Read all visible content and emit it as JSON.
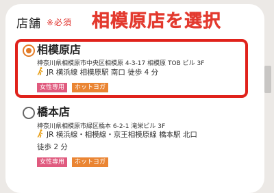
{
  "field": {
    "label": "店舗",
    "required": "※必須"
  },
  "callout": "相模原店を選択",
  "stores": [
    {
      "name": "相模原店",
      "selected": true,
      "address": "神奈川県相模原市中央区相模原 4-3-17 相模原 TOB ビル 3F",
      "access": "JR 横浜線 相模原駅 南口 徒歩 4 分",
      "tags": [
        "女性専用",
        "ホットヨガ"
      ]
    },
    {
      "name": "橋本店",
      "selected": false,
      "address": "神奈川県相模原市緑区橋本 6-2-1 滝栄ビル 3F",
      "access_line1": "JR 横浜線・相模線・京王相模原線 橋本駅 北口",
      "access_line2": "徒歩 2 分",
      "tags": [
        "女性専用",
        "ホットヨガ"
      ]
    }
  ],
  "colors": {
    "accent": "#e37b27",
    "highlight": "#e0221b",
    "tag_women": "#e05a7e",
    "tag_yoga": "#ea8533"
  }
}
